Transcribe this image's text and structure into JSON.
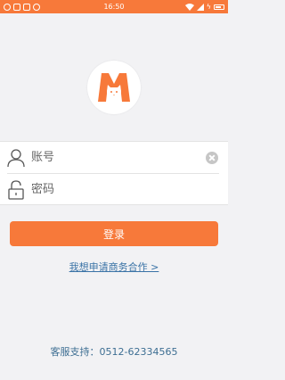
{
  "status_bar": {
    "time": "16:50",
    "battery_icon": "battery-icon",
    "wifi_icon": "wifi-icon"
  },
  "logo": {
    "icon": "cat-logo-icon",
    "colors": {
      "brand": "#f7793a",
      "cat": "#ffffff"
    }
  },
  "form": {
    "account": {
      "placeholder": "账号",
      "value": "",
      "icon": "user-icon",
      "clear_icon": "clear-icon"
    },
    "password": {
      "placeholder": "密码",
      "value": "",
      "icon": "lock-icon"
    }
  },
  "actions": {
    "login_label": "登录",
    "business_link": "我想申请商务合作 >"
  },
  "footer": {
    "support_text": "客服支持：0512-62334565"
  },
  "colors": {
    "accent": "#f7793a",
    "link": "#3a73a6",
    "background": "#f2f2f4"
  }
}
